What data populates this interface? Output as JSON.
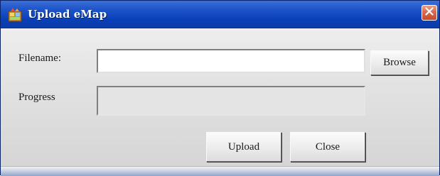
{
  "window": {
    "title": "Upload eMap",
    "icon": "app-icon",
    "close_icon": "close-icon"
  },
  "form": {
    "filename_label": "Filename:",
    "filename_value": "",
    "filename_placeholder": "",
    "browse_label": "Browse",
    "progress_label": "Progress",
    "progress_value": 0
  },
  "actions": {
    "upload_label": "Upload",
    "close_label": "Close"
  },
  "colors": {
    "titlebar": "#1f56c9",
    "close_button": "#d86a4f"
  }
}
